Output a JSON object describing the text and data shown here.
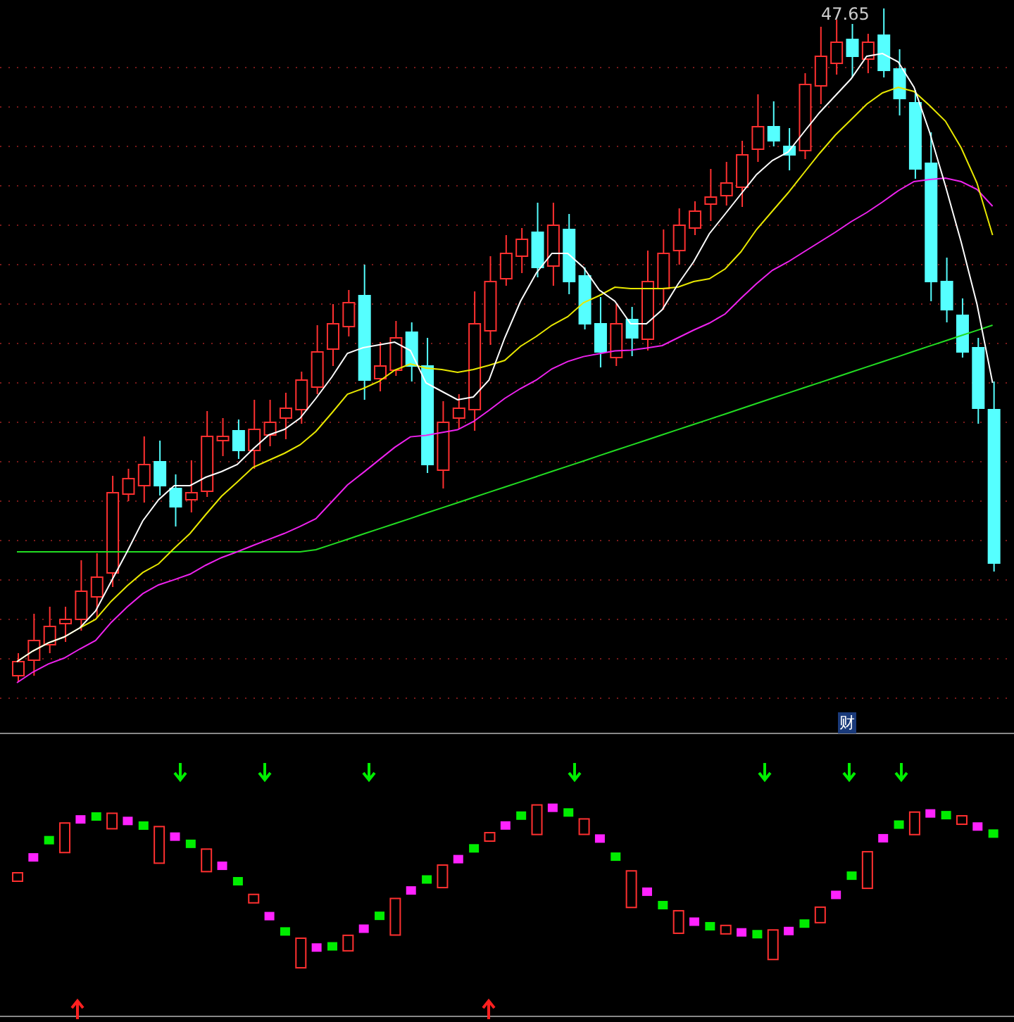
{
  "main_chart": {
    "price_label": "47.65",
    "badge": "财"
  }
}
